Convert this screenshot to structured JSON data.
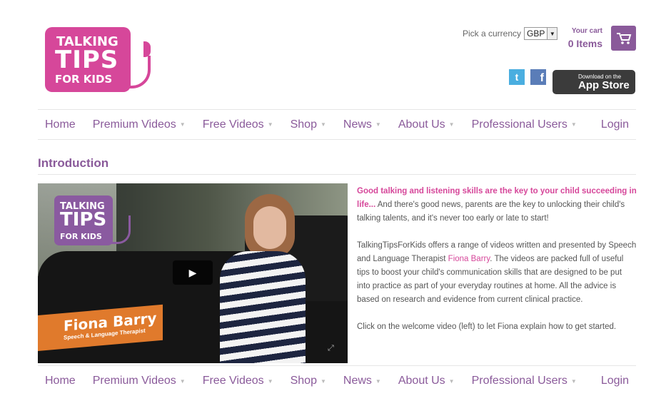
{
  "logo": {
    "line1": "TALKING",
    "line2": "TIPS",
    "line3": "FOR KIDS"
  },
  "header": {
    "currency_label": "Pick a currency",
    "currency_value": "GBP",
    "cart_title": "Your cart",
    "cart_count": "0 Items",
    "twitter_icon": "twitter-icon",
    "facebook_icon": "facebook-icon",
    "appstore_small": "Download on the",
    "appstore_big": "App Store"
  },
  "nav": {
    "items": [
      {
        "label": "Home"
      },
      {
        "label": "Premium Videos"
      },
      {
        "label": "Free Videos"
      },
      {
        "label": "Shop"
      },
      {
        "label": "News"
      },
      {
        "label": "About Us"
      },
      {
        "label": "Professional Users"
      }
    ],
    "login": "Login"
  },
  "main": {
    "title": "Introduction",
    "video": {
      "logo1": "TALKING",
      "logo2": "TIPS",
      "logo3": "FOR KIDS",
      "name": "Fiona Barry",
      "role": "Speech & Language Therapist"
    },
    "lead": "Good talking and listening skills are the key to your child succeeding in life...",
    "p1_rest": " And there's good news, parents are the key to unlocking their child's talking talents, and it's never too early or late to start!",
    "p2_a": "TalkingTipsForKids  offers a range of videos written and presented by Speech and Language Therapist ",
    "p2_link": "Fiona Barry",
    "p2_b": ". The videos are packed full of useful tips to boost your child's communication skills that are designed to be put into practice as part of your everyday routines at home. All the advice is based on research and evidence from current clinical practice.",
    "p3": "Click on the welcome video (left) to let Fiona explain how to get started."
  },
  "colors": {
    "brand_pink": "#d6479a",
    "brand_purple": "#8a5a9a",
    "banner_orange": "#e07a2c"
  }
}
